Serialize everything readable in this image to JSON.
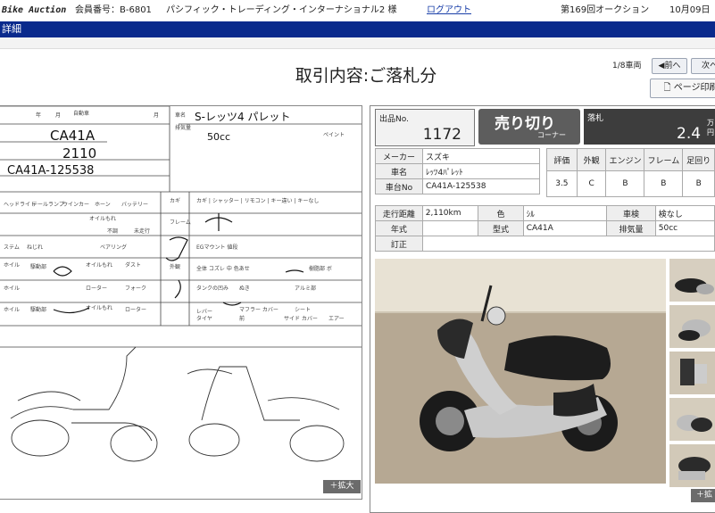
{
  "header": {
    "brand": "Bike Auction",
    "member": "会員番号：B-6801",
    "company": "パシフィック・トレーディング・インターナショナル2 様",
    "logout": "ログアウト",
    "round": "第169回オークション",
    "date": "10月09日"
  },
  "section_bar": "詳細",
  "page_title": "取引内容:ご落札分",
  "pager": {
    "count": "1/8車両",
    "prev": "◀前へ",
    "next": "次へ"
  },
  "print_label": "ページ印刷",
  "lot": {
    "label": "出品No.",
    "number": "1172"
  },
  "status": {
    "main": "売り切り",
    "sub": "コーナー"
  },
  "price": {
    "label": "落札",
    "value": "2.4",
    "unit": "万円"
  },
  "spec": {
    "maker_label": "メーカー",
    "maker": "スズキ",
    "model_label": "車名",
    "model": "ﾚｯﾂ4ﾊﾟﾚｯﾄ",
    "frame_label": "車台No",
    "frame": "CA41A-125538"
  },
  "grades": {
    "headers": [
      "評価",
      "外観",
      "エンジン",
      "フレーム",
      "足回り"
    ],
    "values": [
      "3.5",
      "C",
      "B",
      "B",
      "B"
    ]
  },
  "details": {
    "mileage_label": "走行距離",
    "mileage": "2,110km",
    "color_label": "色",
    "color": "ｼﾙ",
    "inspection_label": "車検",
    "inspection": "検なし",
    "year_label": "年式",
    "year": "",
    "type_label": "型式",
    "type": "CA41A",
    "displacement_label": "排気量",
    "displacement": "50cc",
    "correction_label": "訂正",
    "correction": ""
  },
  "sheet": {
    "model_code": "CA41A",
    "mileage": "2110",
    "frame_no": "CA41A-125538",
    "name": "S-レッツ4 パレット",
    "cc": "50cc"
  },
  "zoom_label": "＋拡大",
  "zoom_label_short": "＋拡"
}
